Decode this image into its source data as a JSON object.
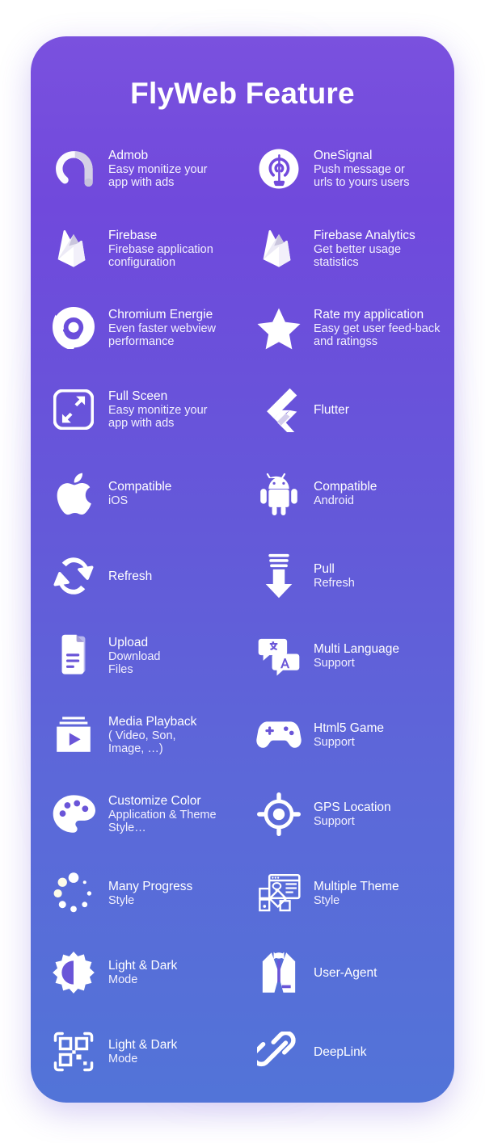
{
  "card": {
    "title": "FlyWeb Feature",
    "gradient_top": "#7A51DE",
    "gradient_bottom": "#5274D8",
    "text_color": "#FFFFFF"
  },
  "features": [
    {
      "icon": "admob-icon",
      "title": "Admob",
      "subtitle": "Easy monitize your\napp with ads"
    },
    {
      "icon": "onesignal-icon",
      "title": "OneSignal",
      "subtitle": "Push message or\nurls to yours users"
    },
    {
      "icon": "firebase-icon",
      "title": "Firebase",
      "subtitle": "Firebase application\nconfiguration"
    },
    {
      "icon": "firebase-analytics-icon",
      "title": "Firebase Analytics",
      "subtitle": "Get better usage\nstatistics"
    },
    {
      "icon": "chromium-icon",
      "title": "Chromium Energie",
      "subtitle": "Even faster webview\nperformance"
    },
    {
      "icon": "star-icon",
      "title": "Rate my application",
      "subtitle": "Easy get user feed-back\nand ratingss"
    },
    {
      "icon": "fullscreen-icon",
      "title": "Full Sceen",
      "subtitle": "Easy monitize your\napp with ads"
    },
    {
      "icon": "flutter-icon",
      "title": "Flutter",
      "subtitle": ""
    },
    {
      "icon": "apple-icon",
      "title": "Compatible",
      "subtitle": "iOS"
    },
    {
      "icon": "android-icon",
      "title": "Compatible",
      "subtitle": "Android"
    },
    {
      "icon": "refresh-icon",
      "title": "Refresh",
      "subtitle": ""
    },
    {
      "icon": "pull-refresh-icon",
      "title": "Pull",
      "subtitle": "Refresh"
    },
    {
      "icon": "files-icon",
      "title": "Upload",
      "subtitle": "Download\nFiles"
    },
    {
      "icon": "translate-icon",
      "title": "Multi Language",
      "subtitle": "Support"
    },
    {
      "icon": "media-playback-icon",
      "title": "Media Playback",
      "subtitle": "( Video, Son,\n Image, …)"
    },
    {
      "icon": "gamepad-icon",
      "title": "Html5 Game",
      "subtitle": "Support"
    },
    {
      "icon": "palette-icon",
      "title": "Customize Color",
      "subtitle": "Application & Theme\nStyle…"
    },
    {
      "icon": "gps-location-icon",
      "title": "GPS Location",
      "subtitle": "Support"
    },
    {
      "icon": "progress-spinner-icon",
      "title": "Many Progress",
      "subtitle": "Style"
    },
    {
      "icon": "theme-layout-icon",
      "title": "Multiple Theme",
      "subtitle": "Style"
    },
    {
      "icon": "light-dark-icon",
      "title": "Light & Dark",
      "subtitle": "Mode"
    },
    {
      "icon": "user-agent-icon",
      "title": "User-Agent",
      "subtitle": ""
    },
    {
      "icon": "qr-code-icon",
      "title": "Light & Dark",
      "subtitle": "Mode"
    },
    {
      "icon": "deeplink-icon",
      "title": "DeepLink",
      "subtitle": ""
    }
  ]
}
